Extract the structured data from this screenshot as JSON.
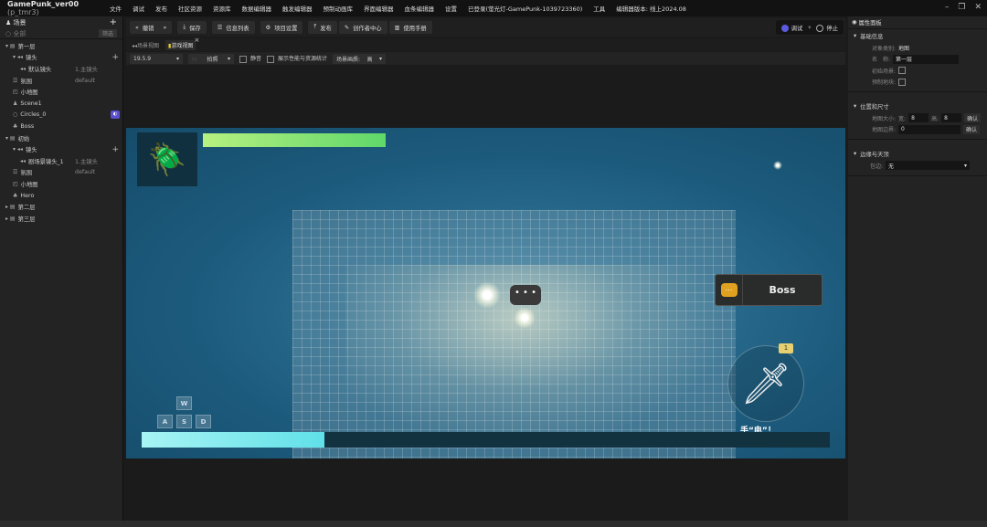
{
  "titlebar": {
    "app": "GamePunk_ver00",
    "project": "(p_tmr3)",
    "menu": [
      "文件",
      "调试",
      "发布",
      "社区资源",
      "资源库",
      "数据编辑器",
      "触发编辑器",
      "预制动画库",
      "界面编辑器",
      "血条编辑器",
      "设置",
      "已登录(萤光灯-GamePunk-1039723360)",
      "工具",
      "编辑器版本: 线上2024.08"
    ]
  },
  "left": {
    "title": "场景",
    "search_placeholder": "全部",
    "filter": "筛选",
    "tree": [
      {
        "label": "第一层",
        "level": 0,
        "icon": "▾ ▤"
      },
      {
        "label": "镜头",
        "level": 1,
        "icon": "▾ ◂◂",
        "plus": true
      },
      {
        "label": "默认镜头",
        "level": 2,
        "icon": "◂◂",
        "tag": "1.主镜头"
      },
      {
        "label": "氛围",
        "level": 1,
        "icon": "☲",
        "tag": "default"
      },
      {
        "label": "小地图",
        "level": 1,
        "icon": "◰"
      },
      {
        "label": "Scene1",
        "level": 1,
        "icon": "♟"
      },
      {
        "label": "Circles_0",
        "level": 1,
        "icon": "○",
        "badge": true
      },
      {
        "label": "Boss",
        "level": 1,
        "icon": "♣"
      },
      {
        "label": "初始",
        "level": 0,
        "icon": "▾ ▤"
      },
      {
        "label": "镜头",
        "level": 1,
        "icon": "▾ ◂◂",
        "plus": true
      },
      {
        "label": "剧场景镜头_1",
        "level": 2,
        "icon": "◂◂",
        "tag": "1.主镜头"
      },
      {
        "label": "氛围",
        "level": 1,
        "icon": "☲",
        "tag": "default"
      },
      {
        "label": "小地图",
        "level": 1,
        "icon": "◰"
      },
      {
        "label": "Hero",
        "level": 1,
        "icon": "♣"
      },
      {
        "label": "第二层",
        "level": 0,
        "icon": "▸ ▤"
      },
      {
        "label": "第三层",
        "level": 0,
        "icon": "▸ ▤"
      }
    ]
  },
  "toolbar": {
    "undo": "撤销",
    "save": "保存",
    "info_list": "信息列表",
    "project_settings": "项目设置",
    "publish": "发布",
    "creator_center": "创作者中心",
    "manual": "使用手册",
    "debug": "调试",
    "stop": "停止"
  },
  "tabs": [
    "场景视图",
    "游戏视图"
  ],
  "options": {
    "version": "19.5.9",
    "camera": "拍照",
    "mute": "静音",
    "show_stats": "展示性能与资源统计",
    "quality_label": "场景画质:",
    "quality": "高"
  },
  "game": {
    "boss_label": "Boss",
    "bubble": "• • •",
    "skill_count": "1",
    "skill_label": "手“电”！",
    "keys": [
      "W",
      "A",
      "S",
      "D"
    ],
    "health_fraction": 1.0,
    "progress_fraction": 0.265
  },
  "right": {
    "title": "属性面板",
    "basic": {
      "title": "基础信息",
      "type_label": "对象类别:",
      "type": "地图",
      "name_label": "名　称:",
      "name": "第一层",
      "initial_label": "初始场景:",
      "prefab_label": "预制地块:"
    },
    "pos": {
      "title": "位置和尺寸",
      "size_label": "地图大小:",
      "w_label": "宽:",
      "w": "8",
      "h_label": "高:",
      "h": "8",
      "confirm": "确认",
      "border_label": "地图边界:",
      "border": "0",
      "confirm2": "确认"
    },
    "edge": {
      "title": "边缘与天顶",
      "wrap_label": "包边:",
      "wrap": "无"
    }
  }
}
